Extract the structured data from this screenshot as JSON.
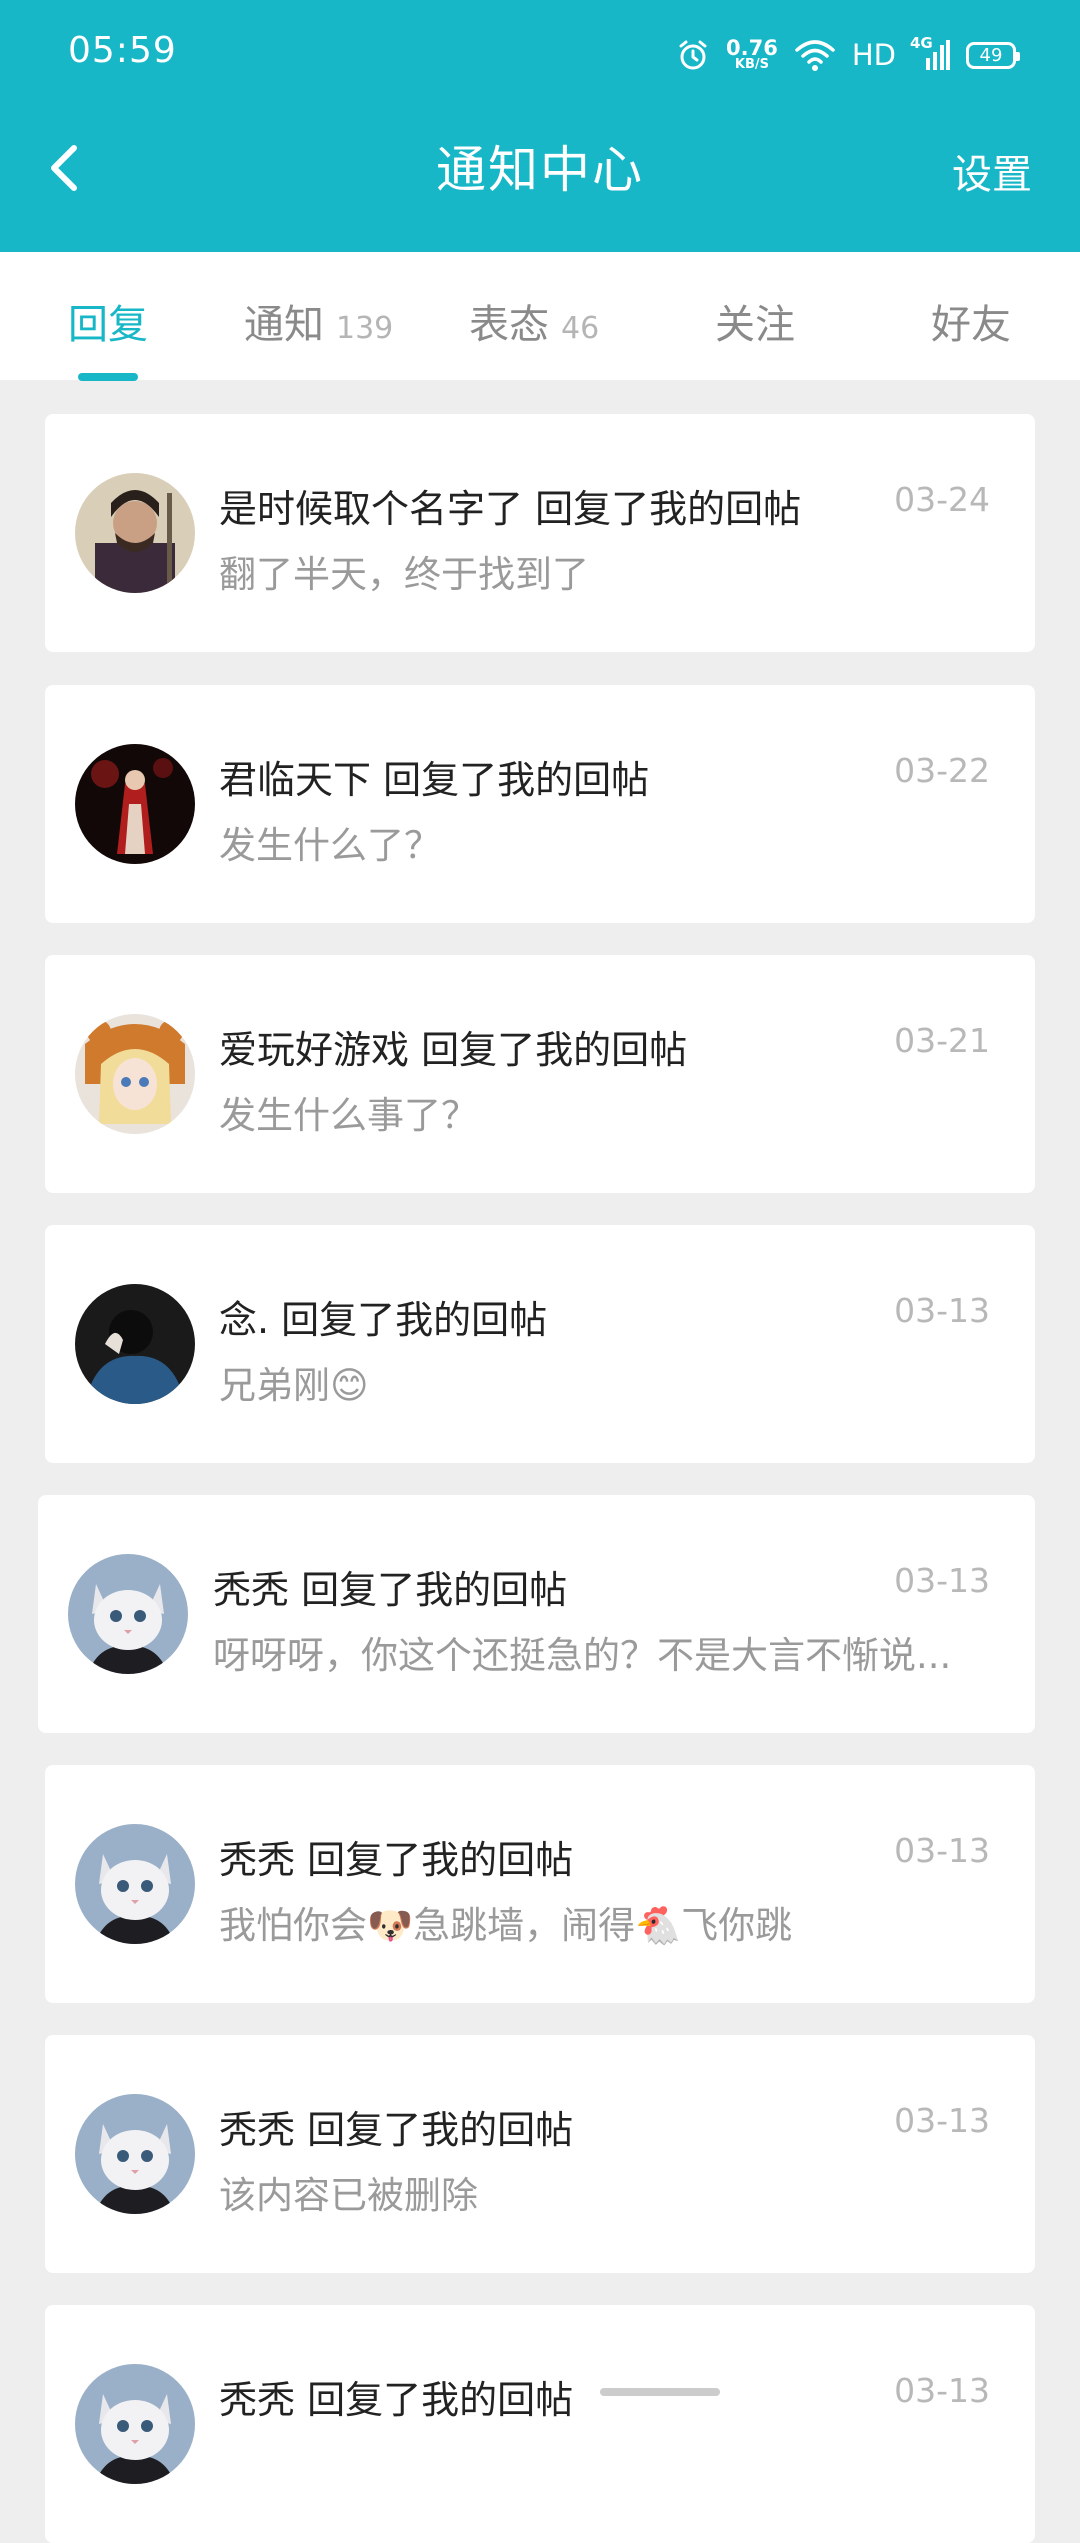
{
  "status_bar": {
    "time": "05:59",
    "net_speed": "0.76",
    "net_unit": "KB/S",
    "hd": "HD",
    "network": "4G",
    "battery": "49"
  },
  "nav": {
    "title": "通知中心",
    "settings": "设置"
  },
  "tabs": [
    {
      "label": "回复",
      "count": "",
      "active": true
    },
    {
      "label": "通知",
      "count": "139",
      "active": false
    },
    {
      "label": "表态",
      "count": "46",
      "active": false
    },
    {
      "label": "关注",
      "count": "",
      "active": false
    },
    {
      "label": "好友",
      "count": "",
      "active": false
    }
  ],
  "replies": [
    {
      "title": "是时候取个名字了 回复了我的回帖",
      "preview": "翻了半天，终于找到了",
      "date": "03-24"
    },
    {
      "title": "君临天下 回复了我的回帖",
      "preview": "发生什么了？",
      "date": "03-22"
    },
    {
      "title": "爱玩好游戏 回复了我的回帖",
      "preview": "发生什么事了？",
      "date": "03-21"
    },
    {
      "title": "念. 回复了我的回帖",
      "preview": "兄弟刚😊",
      "date": "03-13"
    },
    {
      "title": "秃秃 回复了我的回帖",
      "preview": "呀呀呀，你这个还挺急的？不是大言不惭说...",
      "date": "03-13"
    },
    {
      "title": "秃秃 回复了我的回帖",
      "preview": "我怕你会🐶急跳墙，闹得🐔飞你跳",
      "date": "03-13"
    },
    {
      "title": "秃秃 回复了我的回帖",
      "preview": "该内容已被删除",
      "date": "03-13"
    },
    {
      "title": "秃秃 回复了我的回帖",
      "preview": "",
      "date": "03-13"
    }
  ],
  "colors": {
    "accent": "#17b7c7",
    "background": "#eeeeee",
    "card": "#ffffff"
  }
}
